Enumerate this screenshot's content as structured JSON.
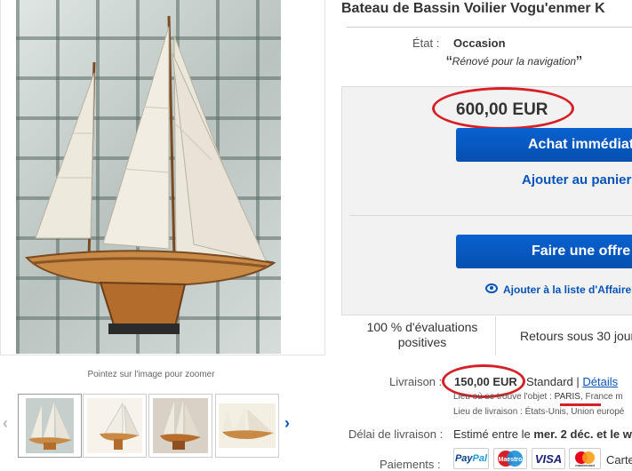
{
  "gallery": {
    "zoom_hint": "Pointez sur l'image pour zoomer",
    "prev_arrow": "‹",
    "next_arrow": "›"
  },
  "item": {
    "title": "Bateau de Bassin Voilier Vogu'enmer K",
    "condition_label": "État :",
    "condition_value": "Occasion",
    "condition_note": "Rénové pour la navigation"
  },
  "buy_box": {
    "price": "600,00 EUR",
    "buy_now_label": "Achat immédiat",
    "add_to_cart_label": "Ajouter au panier",
    "make_offer_label": "Faire une offre",
    "watchlist_label": "Ajouter à la liste d'Affaires"
  },
  "stats": {
    "feedback": "100 % d'évaluations positives",
    "returns": "Retours sous 30 jours"
  },
  "shipping": {
    "label": "Livraison :",
    "price": "150,00 EUR",
    "method": "Standard",
    "separator": "|",
    "details_link": "Détails",
    "item_location_label": "Lieu où se trouve l'objet :",
    "item_location_city": "PARIS",
    "item_location_rest": ", France m",
    "ships_to_label": "Lieu de livraison :",
    "ships_to_value": "États-Unis, Union europé"
  },
  "delivery": {
    "label": "Délai de livraison :",
    "prefix": "Estimé entre le",
    "date": "mer. 2 déc. et le w"
  },
  "payments": {
    "label": "Paiements :",
    "paypal_a": "Pay",
    "paypal_b": "Pal",
    "maestro": "Maestro",
    "visa": "VISA",
    "mastercard": "mastercard",
    "cards_text": "Carte"
  },
  "colors": {
    "ebay_blue": "#0654ba",
    "annotation_red": "#d62027"
  }
}
